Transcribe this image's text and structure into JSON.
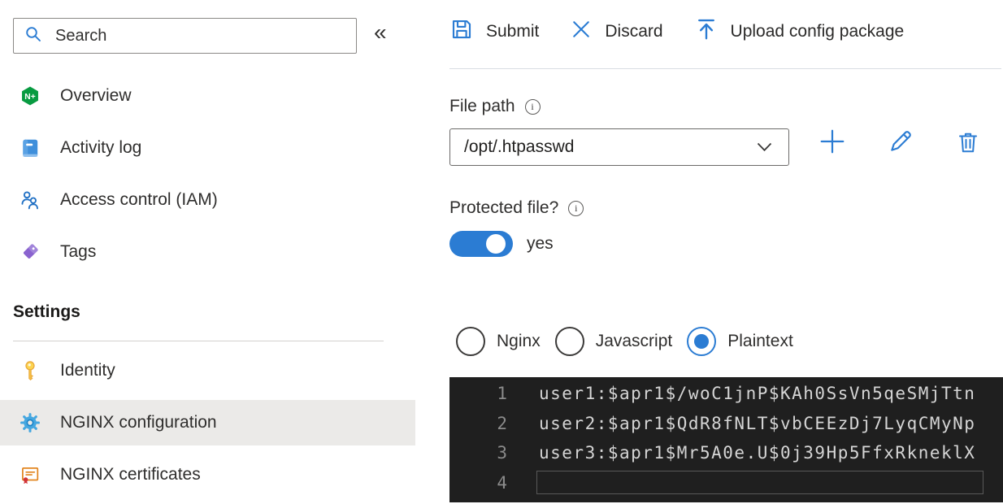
{
  "colors": {
    "accent_blue": "#2b7cd3",
    "nginx_green": "#089b41",
    "selected_row_bg": "#ebeae8",
    "editor_bg": "#1f1f1f",
    "editor_text": "#d5d5d5",
    "editor_line_number": "#8b8b8b"
  },
  "sidebar": {
    "search": {
      "placeholder": "Search"
    },
    "collapse_icon": "double-chevron-left-icon",
    "collapse_glyph": "«",
    "items": [
      {
        "label": "Overview",
        "icon": "nginx-logo-icon"
      },
      {
        "label": "Activity log",
        "icon": "activity-log-icon"
      },
      {
        "label": "Access control (IAM)",
        "icon": "people-icon"
      },
      {
        "label": "Tags",
        "icon": "tag-icon"
      }
    ],
    "settings_header": "Settings",
    "settings_items": [
      {
        "label": "Identity",
        "icon": "key-icon",
        "selected": false
      },
      {
        "label": "NGINX configuration",
        "icon": "gear-icon",
        "selected": true
      },
      {
        "label": "NGINX certificates",
        "icon": "certificate-icon",
        "selected": false
      }
    ]
  },
  "toolbar": {
    "submit_label": "Submit",
    "discard_label": "Discard",
    "upload_label": "Upload config package"
  },
  "file_path": {
    "label": "File path",
    "info_glyph": "i",
    "value": "/opt/.htpasswd",
    "actions": [
      "add",
      "edit",
      "delete"
    ]
  },
  "protected_file": {
    "label": "Protected file?",
    "info_glyph": "i",
    "toggle_on": true,
    "state_label": "yes"
  },
  "syntax_options": [
    {
      "label": "Nginx",
      "selected": false
    },
    {
      "label": "Javascript",
      "selected": false
    },
    {
      "label": "Plaintext",
      "selected": true
    }
  ],
  "editor": {
    "lines": [
      {
        "number": "1",
        "text": "user1:$apr1$/woC1jnP$KAh0SsVn5qeSMjTtn"
      },
      {
        "number": "2",
        "text": "user2:$apr1$QdR8fNLT$vbCEEzDj7LyqCMyNp"
      },
      {
        "number": "3",
        "text": "user3:$apr1$Mr5A0e.U$0j39Hp5FfxRkneklX"
      },
      {
        "number": "4",
        "text": ""
      }
    ],
    "cursor_line": 4
  }
}
